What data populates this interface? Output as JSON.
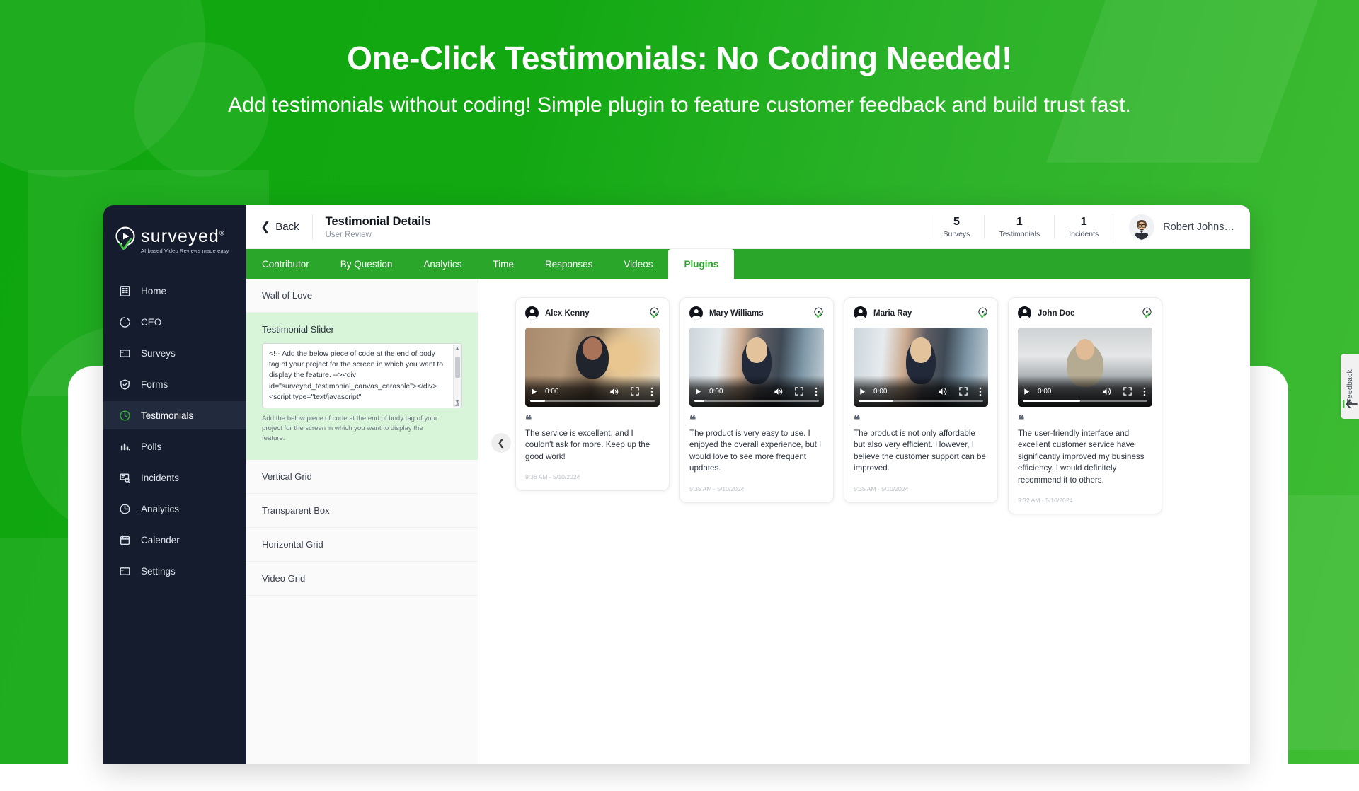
{
  "promo": {
    "title": "One-Click Testimonials: No Coding Needed!",
    "subtitle": "Add testimonials without coding! Simple plugin to feature customer feedback and build trust fast."
  },
  "sidebar": {
    "logo_text": "surveyed",
    "logo_registered": "®",
    "logo_tagline": "AI based Video Reviews made easy",
    "items": [
      {
        "label": "Home",
        "icon": "building-icon",
        "active": false
      },
      {
        "label": "CEO",
        "icon": "donut-chart-icon",
        "active": false
      },
      {
        "label": "Surveys",
        "icon": "folder-icon",
        "active": false
      },
      {
        "label": "Forms",
        "icon": "shield-check-icon",
        "active": false
      },
      {
        "label": "Testimonials",
        "icon": "clock-icon",
        "active": true
      },
      {
        "label": "Polls",
        "icon": "bar-chart-icon",
        "active": false
      },
      {
        "label": "Incidents",
        "icon": "search-card-icon",
        "active": false
      },
      {
        "label": "Analytics",
        "icon": "pie-chart-icon",
        "active": false
      },
      {
        "label": "Calender",
        "icon": "calendar-icon",
        "active": false
      },
      {
        "label": "Settings",
        "icon": "folder-icon",
        "active": false
      }
    ]
  },
  "header": {
    "back_label": "Back",
    "back_icon": "chevron-left-icon",
    "title": "Testimonial Details",
    "subtitle": "User Review",
    "stats": [
      {
        "value": "5",
        "label": "Surveys"
      },
      {
        "value": "1",
        "label": "Testimonials"
      },
      {
        "value": "1",
        "label": "Incidents"
      }
    ],
    "user_name": "Robert Johns…",
    "avatar_icon": "user-avatar"
  },
  "tabs": [
    {
      "label": "Contributor",
      "active": false
    },
    {
      "label": "By Question",
      "active": false
    },
    {
      "label": "Analytics",
      "active": false
    },
    {
      "label": "Time",
      "active": false
    },
    {
      "label": "Responses",
      "active": false
    },
    {
      "label": "Videos",
      "active": false
    },
    {
      "label": "Plugins",
      "active": true
    }
  ],
  "plugins": {
    "items": [
      {
        "label": "Wall of Love",
        "selected": false
      },
      {
        "label": "Testimonial Slider",
        "selected": true
      },
      {
        "label": "Vertical Grid",
        "selected": false
      },
      {
        "label": "Transparent Box",
        "selected": false
      },
      {
        "label": "Horizontal Grid",
        "selected": false
      },
      {
        "label": "Video Grid",
        "selected": false
      }
    ],
    "code_snippet": "<!-- Add the below piece of code at the end of body tag of your project for the screen in which you want to display the feature. --><div id=\"surveyed_testimonial_canvas_carasole\"></div> <script  type=\"text/javascript\"",
    "hint": "Add the below piece of code at the end of body tag of your project for the screen in which you want to display the feature."
  },
  "carousel": {
    "prev_icon": "chevron-left-icon",
    "cards": [
      {
        "name": "Alex Kenny",
        "badge_icon": "verified-pin-icon",
        "video_time": "0:00",
        "quote": "The service is excellent, and I couldn't ask for more. Keep up the good work!",
        "timestamp": "9:36 AM - 5/10/2024"
      },
      {
        "name": "Mary Williams",
        "badge_icon": "verified-pin-icon",
        "video_time": "0:00",
        "quote": "The product is very easy to use. I enjoyed the overall experience, but I would love to see more frequent updates.",
        "timestamp": "9:35 AM - 5/10/2024"
      },
      {
        "name": "Maria Ray",
        "badge_icon": "verified-pin-icon",
        "video_time": "0:00",
        "quote": "The product is not only affordable but also very efficient. However, I believe the customer support can be improved.",
        "timestamp": "9:35 AM - 5/10/2024"
      },
      {
        "name": "John Doe",
        "badge_icon": "verified-pin-icon",
        "video_time": "0:00",
        "quote": "The user-friendly interface and excellent customer service have significantly improved my business efficiency. I would definitely recommend it to others.",
        "timestamp": "9:32 AM - 5/10/2024"
      }
    ]
  },
  "feedback": {
    "label": "Feedback",
    "icon": "arrow-left-bar-icon"
  },
  "colors": {
    "brand_green": "#2aa72a",
    "promo_green": "#0ea60e",
    "sidebar_dark": "#151c2e",
    "accent_light_green": "#d9f5d9"
  }
}
